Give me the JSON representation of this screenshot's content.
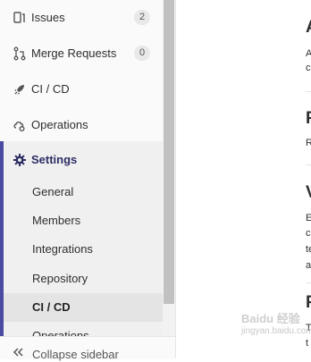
{
  "sidebar": {
    "items": [
      {
        "label": "Issues",
        "badge": "2",
        "icon": "issues-icon"
      },
      {
        "label": "Merge Requests",
        "badge": "0",
        "icon": "merge-request-icon"
      },
      {
        "label": "CI / CD",
        "icon": "rocket-icon"
      },
      {
        "label": "Operations",
        "icon": "cloud-gear-icon"
      },
      {
        "label": "Settings",
        "icon": "gear-icon"
      }
    ],
    "settings_subitems": [
      {
        "label": "General"
      },
      {
        "label": "Members"
      },
      {
        "label": "Integrations"
      },
      {
        "label": "Repository"
      },
      {
        "label": "CI / CD",
        "active": true
      },
      {
        "label": "Operations"
      }
    ],
    "collapse_label": "Collapse sidebar"
  },
  "content": {
    "sections": [
      {
        "title": "A",
        "lines": [
          "A",
          "c"
        ]
      },
      {
        "title": "P",
        "lines": [
          "R"
        ]
      },
      {
        "title": "V",
        "lines": [
          "E",
          "c",
          "te",
          "a"
        ]
      },
      {
        "title": "P",
        "lines": [
          "T",
          "t"
        ]
      }
    ]
  },
  "watermark": {
    "line1": "Baidu 经验",
    "line2": "jingyan.baidu.com"
  },
  "colors": {
    "accent": "#4b4ba3",
    "sidebar_bg": "#fafafa",
    "active_bg": "#e4e4e4"
  }
}
